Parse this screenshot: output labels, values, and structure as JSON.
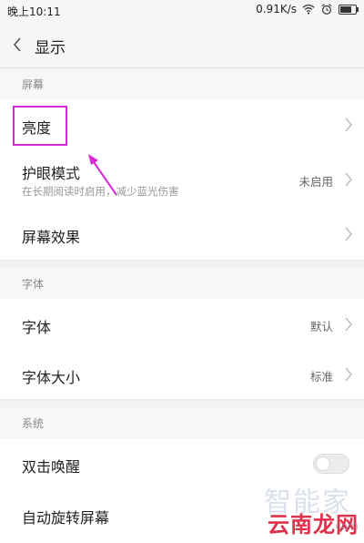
{
  "status_bar": {
    "time": "晚上10:11",
    "network_speed": "0.91K/s",
    "battery_level": 0.85
  },
  "nav": {
    "back_icon": "chevron-left-icon",
    "title": "显示"
  },
  "sections": {
    "screen": {
      "header": "屏幕",
      "brightness": {
        "label": "亮度"
      },
      "eye_care": {
        "label": "护眼模式",
        "sub": "在长期阅读时启用，减少蓝光伤害",
        "value": "未启用"
      },
      "screen_effect": {
        "label": "屏幕效果"
      }
    },
    "font": {
      "header": "字体",
      "font_family": {
        "label": "字体",
        "value": "默认"
      },
      "font_size": {
        "label": "字体大小",
        "value": "标准"
      }
    },
    "system": {
      "header": "系统",
      "double_tap_wake": {
        "label": "双击唤醒",
        "toggle_on": false
      },
      "auto_rotate": {
        "label": "自动旋转屏幕"
      }
    }
  },
  "annotation": {
    "highlight_color": "#d62ad6"
  },
  "watermark": {
    "top_text": "智能家",
    "main_text": "云南龙网",
    "sub_text": ".com"
  }
}
